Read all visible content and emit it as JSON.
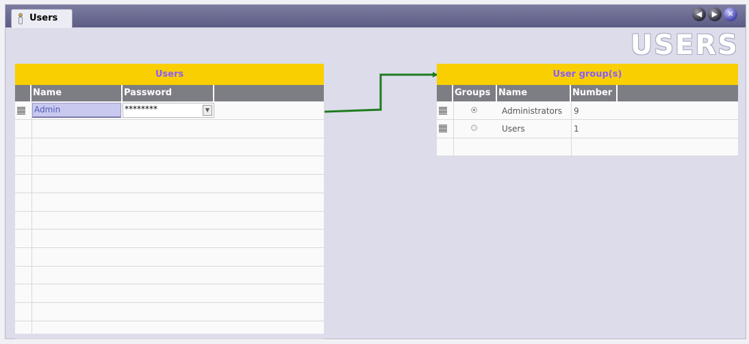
{
  "window": {
    "tab_label": "Users",
    "big_title": "USERS",
    "nav": {
      "back": "◀",
      "forward": "▶",
      "close": "✕"
    }
  },
  "users_table": {
    "title": "Users",
    "columns": [
      "Name",
      "Password"
    ],
    "rows": [
      {
        "name": "Admin",
        "password": "********"
      }
    ]
  },
  "groups_table": {
    "title": "User group(s)",
    "columns": [
      "Groups",
      "Name",
      "Number"
    ],
    "rows": [
      {
        "selected": true,
        "name": "Administrators",
        "number": "9"
      },
      {
        "selected": false,
        "name": "Users",
        "number": "1"
      }
    ]
  },
  "colors": {
    "header_yellow": "#f9cf02",
    "link_arrow": "#1f7a1f"
  }
}
